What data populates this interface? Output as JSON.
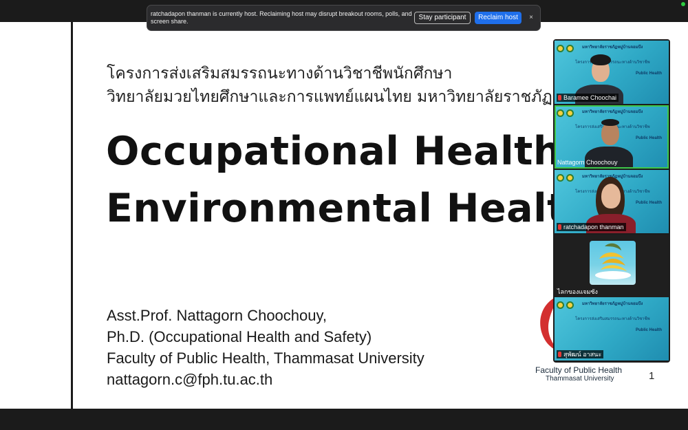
{
  "notification": {
    "message": "ratchadapon thanman is currently host. Reclaiming host may disrupt breakout rooms, polls, and screen share.",
    "stay_label": "Stay participant",
    "reclaim_label": "Reclaim host",
    "close_symbol": "×",
    "close_icon": "close-icon"
  },
  "slide": {
    "thai_line_1": "โครงการส่งเสริมสมรรถนะทางด้านวิชาชีพนักศึกษา",
    "thai_line_2": "วิทยาลัยมวยไทยศึกษาและการแพทย์แผนไทย มหาวิทยาลัยราชภัฏห",
    "title_line_1": "Occupational Health &",
    "title_line_2": "Environmental Health",
    "author_lines": [
      "Asst.Prof. Nattagorn Choochouy,",
      "Ph.D. (Occupational Health and Safety)",
      "Faculty of Public Health, Thammasat University",
      "nattagorn.c@fph.tu.ac.th"
    ],
    "faculty_name": "Faculty of Public Health",
    "faculty_sub": "Thammasat University",
    "page_number": "1"
  },
  "participants": [
    {
      "name": "Baramee Choochai",
      "muted": true
    },
    {
      "name": "Nattagorn Choochouy",
      "active_speaker": true
    },
    {
      "name": "ratchadapon thanman",
      "muted": true
    },
    {
      "name": "ไลกของแจมซัง",
      "video": false
    },
    {
      "name": "สุพัฒน์ อาสนะ",
      "muted": true
    }
  ],
  "tile_overlay": {
    "header": "มหาวิทยาลัยราชภัฏหมู่บ้านจอมบึง",
    "project": "โครงการส่งเสริมสมรรถนะทางด้านวิชาชีพ",
    "subject": "Public Health"
  },
  "colors": {
    "accent": "#1f6feb",
    "active_speaker": "#3ec84b",
    "muted": "#e53935",
    "tile_teal": "#2fa9c6"
  }
}
